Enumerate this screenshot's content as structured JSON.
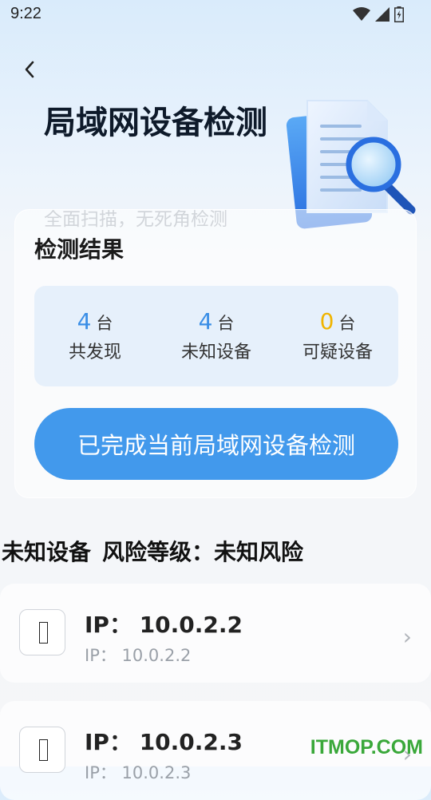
{
  "status_bar": {
    "time": "9:22"
  },
  "header": {
    "title": "局域网设备检测",
    "subtitle": "全面扫描，无死角检测"
  },
  "result_card": {
    "title": "检测结果",
    "stats": [
      {
        "value": "4",
        "unit": "台",
        "label": "共发现",
        "color": "#3a8ee6"
      },
      {
        "value": "4",
        "unit": "台",
        "label": "未知设备",
        "color": "#3a8ee6"
      },
      {
        "value": "0",
        "unit": "台",
        "label": "可疑设备",
        "color": "#f0b400"
      }
    ],
    "button_label": "已完成当前局域网设备检测"
  },
  "section": {
    "category": "未知设备",
    "risk_label": "风险等级：未知风险"
  },
  "devices": [
    {
      "ip_main": "IP：  10.0.2.2",
      "ip_sub": "IP：  10.0.2.2"
    },
    {
      "ip_main": "IP：  10.0.2.3",
      "ip_sub": "IP：  10.0.2.3"
    }
  ],
  "watermark": "ITMOP.COM",
  "colors": {
    "accent": "#4299ec",
    "warning": "#f0b400"
  }
}
